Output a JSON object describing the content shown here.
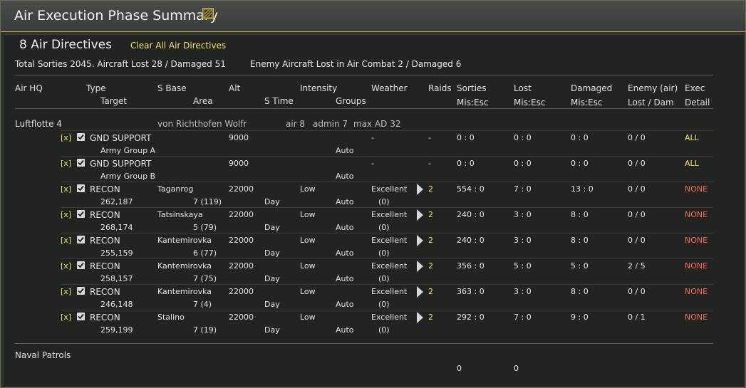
{
  "window": {
    "title": "Air Execution Phase Summary"
  },
  "summary": {
    "directives_heading": "8 Air Directives",
    "clear_all_label": "Clear All Air Directives",
    "totals_text": "Total Sorties 2045. Aircraft Lost 28 / Damaged 51",
    "enemy_text": "Enemy Aircraft Lost in Air Combat 2 / Damaged 6"
  },
  "headers": {
    "row1": [
      "Air HQ",
      "Type",
      "S Base",
      "Alt",
      "Intensity",
      "Weather",
      "Raids",
      "Sorties",
      "Lost",
      "Damaged",
      "Enemy (air)",
      "Exec"
    ],
    "row2": [
      "Target",
      "Area",
      "S Time",
      "Groups",
      "Mis:Esc",
      "Mis:Esc",
      "Mis:Esc",
      "Lost / Dam",
      "Detail"
    ]
  },
  "hq": {
    "name": "Luftflotte 4",
    "commander": "von Richthofen Wolfr",
    "air": "air 8",
    "admin": "admin 7",
    "max_ad": "max AD 32"
  },
  "directives": [
    {
      "x": "[x]",
      "type": "GND SUPPORT",
      "target": "Army Group A",
      "base": "",
      "area": "",
      "alt": "9000",
      "intensity": "",
      "stime": "",
      "groups": "Auto",
      "weather": "-",
      "weather2": "",
      "raids": "-",
      "has_arrow": false,
      "sorties": "0 : 0",
      "lost": "0 : 0",
      "damaged": "0 : 0",
      "enemy": "0 / 0",
      "exec": "ALL",
      "exec_kind": "all"
    },
    {
      "x": "[x]",
      "type": "GND SUPPORT",
      "target": "Army Group B",
      "base": "",
      "area": "",
      "alt": "9000",
      "intensity": "",
      "stime": "",
      "groups": "Auto",
      "weather": "-",
      "weather2": "",
      "raids": "-",
      "has_arrow": false,
      "sorties": "0 : 0",
      "lost": "0 : 0",
      "damaged": "0 : 0",
      "enemy": "0 / 0",
      "exec": "ALL",
      "exec_kind": "all"
    },
    {
      "x": "[x]",
      "type": "RECON",
      "target": "262,187",
      "base": "Taganrog",
      "area": "7 (119)",
      "alt": "22000",
      "intensity": "Low",
      "stime": "Day",
      "groups": "Auto",
      "weather": "Excellent",
      "weather2": "(0)",
      "raids": "2",
      "has_arrow": true,
      "sorties": "554 : 0",
      "lost": "7 : 0",
      "damaged": "13 : 0",
      "enemy": "0 / 0",
      "exec": "NONE",
      "exec_kind": "none"
    },
    {
      "x": "[x]",
      "type": "RECON",
      "target": "268,174",
      "base": "Tatsinskaya",
      "area": "5 (79)",
      "alt": "22000",
      "intensity": "Low",
      "stime": "Day",
      "groups": "Auto",
      "weather": "Excellent",
      "weather2": "(0)",
      "raids": "2",
      "has_arrow": true,
      "sorties": "240 : 0",
      "lost": "3 : 0",
      "damaged": "8 : 0",
      "enemy": "0 / 0",
      "exec": "NONE",
      "exec_kind": "none"
    },
    {
      "x": "[x]",
      "type": "RECON",
      "target": "255,159",
      "base": "Kantemirovka",
      "area": "6 (77)",
      "alt": "22000",
      "intensity": "Low",
      "stime": "Day",
      "groups": "Auto",
      "weather": "Excellent",
      "weather2": "(0)",
      "raids": "2",
      "has_arrow": true,
      "sorties": "240 : 0",
      "lost": "3 : 0",
      "damaged": "8 : 0",
      "enemy": "0 / 0",
      "exec": "NONE",
      "exec_kind": "none"
    },
    {
      "x": "[x]",
      "type": "RECON",
      "target": "258,157",
      "base": "Kantemirovka",
      "area": "7 (75)",
      "alt": "22000",
      "intensity": "Low",
      "stime": "Day",
      "groups": "Auto",
      "weather": "Excellent",
      "weather2": "(0)",
      "raids": "2",
      "has_arrow": true,
      "sorties": "356 : 0",
      "lost": "5 : 0",
      "damaged": "5 : 0",
      "enemy": "2 / 5",
      "exec": "NONE",
      "exec_kind": "none"
    },
    {
      "x": "[x]",
      "type": "RECON",
      "target": "246,148",
      "base": "Kantemirovka",
      "area": "7 (4)",
      "alt": "22000",
      "intensity": "Low",
      "stime": "Day",
      "groups": "Auto",
      "weather": "Excellent",
      "weather2": "(0)",
      "raids": "2",
      "has_arrow": true,
      "sorties": "363 : 0",
      "lost": "3 : 0",
      "damaged": "8 : 0",
      "enemy": "0 / 0",
      "exec": "NONE",
      "exec_kind": "none"
    },
    {
      "x": "[x]",
      "type": "RECON",
      "target": "259,199",
      "base": "Stalino",
      "area": "7 (19)",
      "alt": "22000",
      "intensity": "Low",
      "stime": "Day",
      "groups": "Auto",
      "weather": "Excellent",
      "weather2": "(0)",
      "raids": "2",
      "has_arrow": true,
      "sorties": "292 : 0",
      "lost": "7 : 0",
      "damaged": "9 : 0",
      "enemy": "0 / 1",
      "exec": "NONE",
      "exec_kind": "none"
    }
  ],
  "naval": {
    "label": "Naval Patrols",
    "sorties": "0",
    "lost": "0"
  },
  "colors": {
    "accent_yellow": "#f2e36a",
    "none_red": "#ff6a5a",
    "title_border": "#c9a847"
  }
}
